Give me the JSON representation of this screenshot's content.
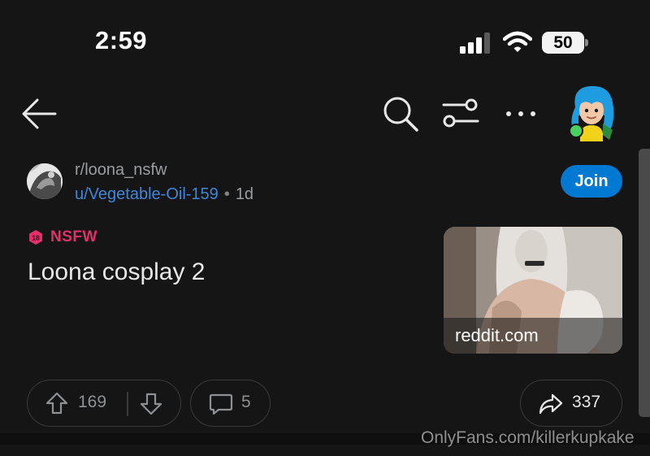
{
  "status_bar": {
    "time": "2:59",
    "battery": "50",
    "icons": [
      "cellular-signal-icon",
      "wifi-icon",
      "battery-icon"
    ]
  },
  "nav": {
    "icons": [
      "back-arrow-icon",
      "search-icon",
      "filter-icon",
      "more-icon",
      "user-avatar"
    ]
  },
  "post": {
    "subreddit": "r/loona_nsfw",
    "author": "u/Vegetable-Oil-159",
    "separator": "•",
    "age": "1d",
    "join_label": "Join",
    "nsfw_label": "NSFW",
    "nsfw_badge_number": "18",
    "title": "Loona cosplay 2",
    "thumbnail_domain": "reddit.com"
  },
  "actions": {
    "upvotes": "169",
    "comments": "5",
    "shares": "337"
  },
  "watermark": "OnlyFans.com/killerkupkake",
  "colors": {
    "background": "#151515",
    "accent": "#0079d3",
    "link": "#3f87d8",
    "nsfw": "#e3306c",
    "online": "#46d160"
  }
}
